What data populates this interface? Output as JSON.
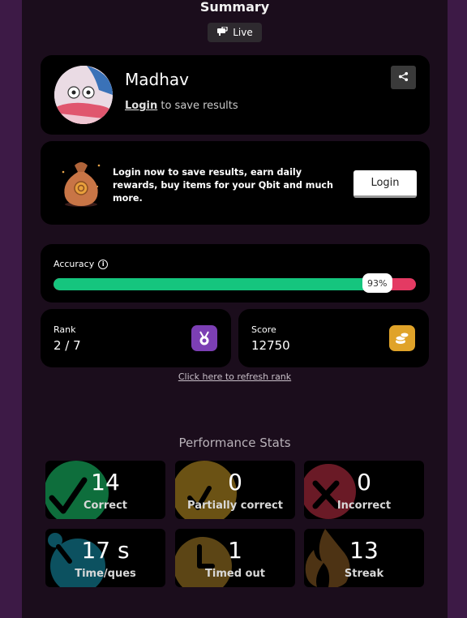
{
  "header": {
    "title": "Summary",
    "live_label": "Live"
  },
  "profile": {
    "name": "Madhav",
    "login_link": "Login",
    "login_suffix": " to save results"
  },
  "promo": {
    "text": "Login now to save results, earn daily rewards, buy items for your Qbit and much more.",
    "button_label": "Login"
  },
  "accuracy": {
    "label": "Accuracy",
    "value_pct": 93,
    "value_label": "93%"
  },
  "rank": {
    "label": "Rank",
    "value": "2 / 7"
  },
  "score": {
    "label": "Score",
    "value": "12750"
  },
  "refresh_link": "Click here to refresh rank",
  "performance": {
    "title": "Performance Stats",
    "tiles": [
      {
        "value": "14",
        "label": "Correct",
        "icon": "check-icon",
        "color": "#0e6e3c"
      },
      {
        "value": "0",
        "label": "Partially correct",
        "icon": "partial-check-icon",
        "color": "#6b5214"
      },
      {
        "value": "0",
        "label": "Incorrect",
        "icon": "cross-icon",
        "color": "#6a1a26"
      },
      {
        "value": "17 s",
        "label": "Time/ques",
        "icon": "stopwatch-icon",
        "color": "#0c5160"
      },
      {
        "value": "1",
        "label": "Timed out",
        "icon": "clock-icon",
        "color": "#5c4515"
      },
      {
        "value": "13",
        "label": "Streak",
        "icon": "fire-icon",
        "color": "#4d3314"
      }
    ]
  },
  "colors": {
    "accuracy_fill": "#15c57e",
    "accuracy_track": "#e43a63",
    "rank_icon_bg": "#7c3fb4",
    "score_icon_bg": "#e0a329"
  }
}
